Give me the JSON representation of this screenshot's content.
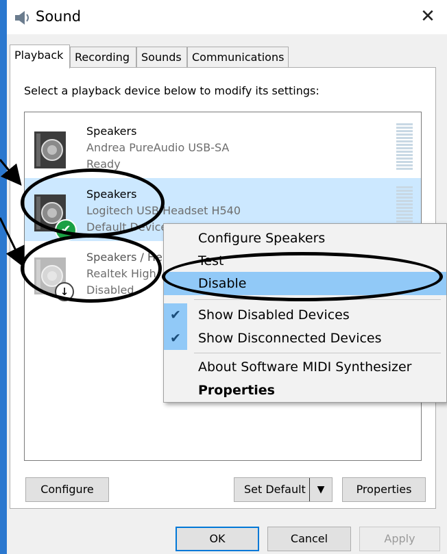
{
  "window": {
    "title": "Sound",
    "close_glyph": "✕"
  },
  "tabs": [
    {
      "label": "Playback",
      "active": true
    },
    {
      "label": "Recording"
    },
    {
      "label": "Sounds"
    },
    {
      "label": "Communications"
    }
  ],
  "instruction": "Select a playback device below to modify its settings:",
  "devices": [
    {
      "name": "Speakers",
      "description": "Andrea PureAudio USB-SA",
      "status": "Ready",
      "icon": "speaker-icon"
    },
    {
      "name": "Speakers",
      "description": "Logitech USB Headset H540",
      "status": "Default Device",
      "icon": "speaker-icon",
      "badge": "checkmark-badge-icon",
      "badge_glyph": "✔",
      "selected": true
    },
    {
      "name": "Speakers / He",
      "description": "Realtek High",
      "status": "Disabled",
      "icon": "speaker-icon",
      "badge": "down-arrow-badge-icon",
      "badge_glyph": "🢃"
    }
  ],
  "context_menu": {
    "items": [
      {
        "label": "Configure Speakers"
      },
      {
        "label": "Test"
      },
      {
        "label": "Disable",
        "highlighted": true
      },
      {
        "label": "Show Disabled Devices",
        "checked": true
      },
      {
        "label": "Show Disconnected Devices",
        "checked": true
      },
      {
        "label": "About Software MIDI Synthesizer"
      },
      {
        "label": "Properties",
        "bold": true
      }
    ],
    "check_glyph": "✔"
  },
  "buttons": {
    "configure": "Configure",
    "set_default": "Set Default",
    "set_default_arrow": "▼",
    "properties": "Properties",
    "ok": "OK",
    "cancel": "Cancel",
    "apply": "Apply"
  },
  "colors": {
    "accent": "#2b78cf",
    "selection": "#cce8ff",
    "menu_highlight": "#91c9f7",
    "default_badge": "#1aa043"
  }
}
